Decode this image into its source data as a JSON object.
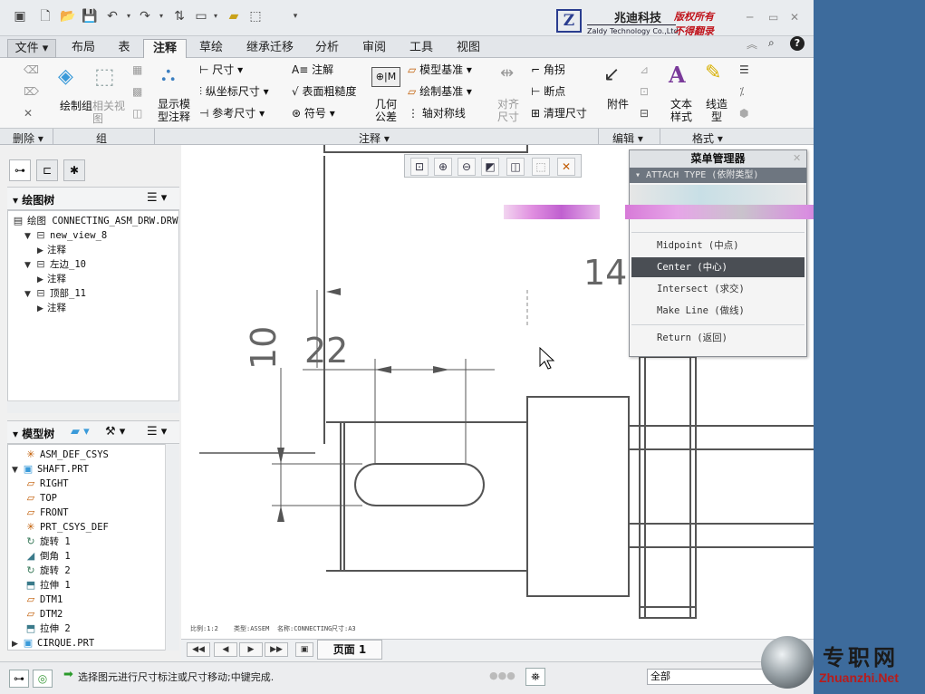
{
  "ribbon_tabs": [
    "文件",
    "布局",
    "表",
    "注释",
    "草绘",
    "继承迁移",
    "分析",
    "审阅",
    "工具",
    "视图"
  ],
  "active_tab": "注释",
  "logo": {
    "mark": "Z",
    "cn": "兆迪科技",
    "en": "Zaldy Technology Co.,Ltd.",
    "r1": "版权所有",
    "r2": "不得翻录"
  },
  "ribbon": {
    "draw_group": "绘制组",
    "related_view": "相关视图",
    "show_model_ann": "显示模型注释",
    "dimension": "尺寸",
    "ordinate_dim": "纵坐标尺寸",
    "ref_dim": "参考尺寸",
    "note": "注解",
    "surface_finish": "表面粗糙度",
    "symbol": "符号",
    "geom_tol": "几何公差",
    "model_datum": "模型基准",
    "draw_datum": "绘制基准",
    "axis_sym": "轴对称线",
    "align_dim": "对齐尺寸",
    "corner": "角拐",
    "breakpoint": "断点",
    "cleanup_dim": "清理尺寸",
    "attach": "附件",
    "text_style": "文本样式",
    "line_style": "线造型"
  },
  "group_labels": {
    "delete": "删除",
    "group": "组",
    "annotate": "注释",
    "edit": "编辑",
    "format": "格式"
  },
  "panel": {
    "draw_tree_title": "绘图树",
    "draw_tree": [
      {
        "label": "绘图 CONNECTING_ASM_DRW.DRW",
        "lvl": 0
      },
      {
        "label": "new_view_8",
        "lvl": 1
      },
      {
        "label": "注释",
        "lvl": 2
      },
      {
        "label": "左边_10",
        "lvl": 1
      },
      {
        "label": "注释",
        "lvl": 2
      },
      {
        "label": "顶部_11",
        "lvl": 1
      },
      {
        "label": "注释",
        "lvl": 2
      }
    ],
    "model_tree_title": "模型树",
    "model_tree": [
      {
        "label": "ASM_DEF_CSYS",
        "lvl": 1
      },
      {
        "label": "SHAFT.PRT",
        "lvl": 0
      },
      {
        "label": "RIGHT",
        "lvl": 1
      },
      {
        "label": "TOP",
        "lvl": 1
      },
      {
        "label": "FRONT",
        "lvl": 1
      },
      {
        "label": "PRT_CSYS_DEF",
        "lvl": 1
      },
      {
        "label": "旋转 1",
        "lvl": 1
      },
      {
        "label": "倒角 1",
        "lvl": 1
      },
      {
        "label": "旋转 2",
        "lvl": 1
      },
      {
        "label": "拉伸 1",
        "lvl": 1
      },
      {
        "label": "DTM1",
        "lvl": 1
      },
      {
        "label": "DTM2",
        "lvl": 1
      },
      {
        "label": "拉伸 2",
        "lvl": 1
      },
      {
        "label": "CIRQUE.PRT",
        "lvl": 0
      }
    ]
  },
  "menu_manager": {
    "title": "菜单管理器",
    "header": "ATTACH TYPE (依附类型)",
    "items": [
      "Midpoint (中点)",
      "Center (中心)",
      "Intersect (求交)",
      "Make Line (做线)"
    ],
    "selected": "Center (中心)",
    "return_item": "Return (返回)"
  },
  "drawing": {
    "dim_14": "14",
    "dim_22": "22",
    "dim_10": "10",
    "footer_scale": "比例:1:2",
    "footer_type": "类型:ASSEM",
    "footer_name": "名称:CONNECTING",
    "footer_size": "尺寸:A3"
  },
  "page_label": "页面 1",
  "status_msg": "选择图元进行尺寸标注或尺寸移动;中键完成.",
  "filter": "全部",
  "watermark": {
    "t1": "专职网",
    "t2": "Zhuanzhi.Net"
  }
}
